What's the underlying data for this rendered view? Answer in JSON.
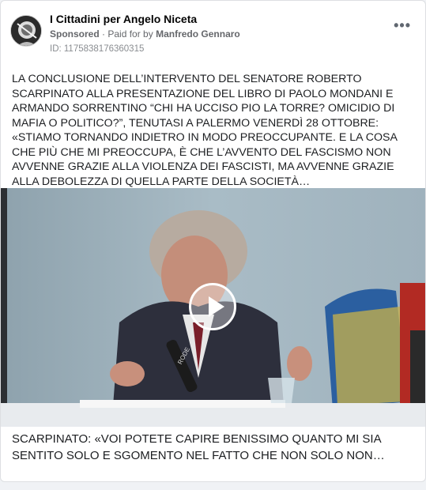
{
  "post": {
    "page_name": "I Cittadini per Angelo Niceta",
    "sponsored_label": "Sponsored",
    "paid_for_prefix": "Paid for by",
    "payer": "Manfredo Gennaro",
    "ad_id": "ID: 1175838176360315",
    "more_label": "•••",
    "body": "LA CONCLUSIONE DELL’INTERVENTO DEL SENATORE ROBERTO SCARPINATO ALLA PRESENTAZIONE DEL LIBRO DI PAOLO MONDANI E ARMANDO SORRENTINO “CHI HA UCCISO PIO LA TORRE? OMICIDIO DI MAFIA O POLITICO?”, TENUTASI A PALERMO VENERDÌ 28 OTTOBRE: «STIAMO TORNANDO INDIETRO IN MODO PREOCCUPANTE. E LA COSA CHE PIÙ CHE MI PREOCCUPA, È CHE L’AVVENTO DEL FASCISMO NON AVVENNE GRAZIE ALLA VIOLENZA DEI FASCISTI, MA AVVENNE GRAZIE ALLA DEBOLEZZA DI QUELLA PARTE DELLA SOCIETÀ…",
    "caption": "SCARPINATO: «VOI POTETE CAPIRE BENISSIMO QUANTO MI SIA SENTITO SOLO E SGOMENTO NEL FATTO CHE NON SOLO NON…"
  },
  "video": {
    "mic_label": "RODE",
    "icons": {
      "play": "play-icon",
      "more": "more-options-icon"
    }
  },
  "colors": {
    "page_bg": "#f0f2f5",
    "card_bg": "#ffffff",
    "text_primary": "#050505",
    "text_secondary": "#65676b"
  }
}
